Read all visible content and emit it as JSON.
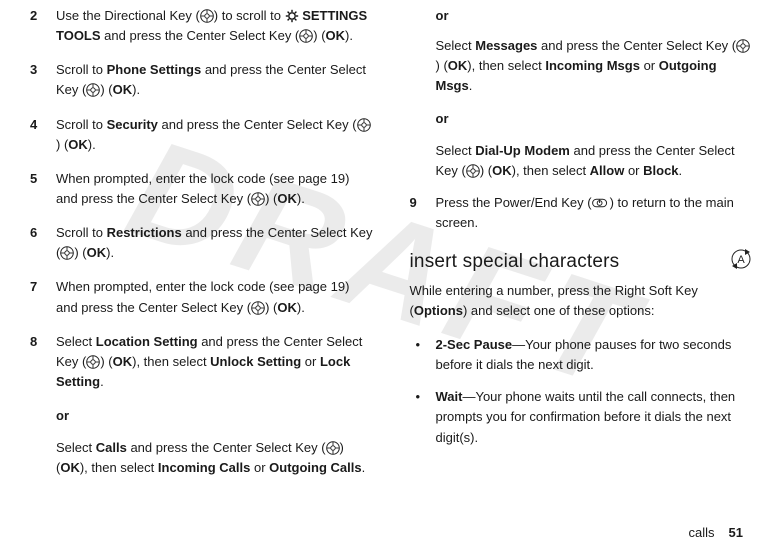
{
  "watermark": "DRAFT",
  "icon_names": {
    "dpad": "dpad-icon",
    "gear": "gear-icon",
    "power": "power-end-icon",
    "abc": "abc-mode-icon"
  },
  "left": {
    "steps": [
      {
        "num": "2",
        "parts": [
          "Use the Directional Key (",
          ") to scroll to ",
          " SETTINGS TOOLS",
          " and press the Center Select Key (",
          ") (",
          "OK",
          ")."
        ]
      },
      {
        "num": "3",
        "parts": [
          "Scroll to ",
          "Phone Settings",
          " and press the Center Select Key (",
          ") (",
          "OK",
          ")."
        ]
      },
      {
        "num": "4",
        "parts": [
          "Scroll to ",
          "Security",
          " and press the Center Select Key (",
          ") (",
          "OK",
          ")."
        ]
      },
      {
        "num": "5",
        "parts": [
          "When prompted, enter the lock code (see page 19) and press the Center Select Key (",
          ") (",
          "OK",
          ")."
        ]
      },
      {
        "num": "6",
        "parts": [
          "Scroll to ",
          "Restrictions",
          " and press the Center Select Key (",
          ") (",
          "OK",
          ")."
        ]
      },
      {
        "num": "7",
        "parts": [
          "When prompted, enter the lock code (see page 19) and press the Center Select Key (",
          ") (",
          "OK",
          ")."
        ]
      },
      {
        "num": "8",
        "parts": [
          "Select ",
          "Location Setting",
          " and press the Center Select Key (",
          ") (",
          "OK",
          "), then select ",
          "Unlock Setting",
          " or ",
          "Lock Setting",
          "."
        ]
      }
    ],
    "or1": "or",
    "calls": [
      "Select ",
      "Calls",
      " and press the Center Select Key (",
      ") (",
      "OK",
      "), then select ",
      "Incoming Calls",
      " or ",
      "Outgoing Calls",
      "."
    ]
  },
  "right": {
    "or1": "or",
    "messages": [
      "Select ",
      "Messages",
      " and press the Center Select Key (",
      ") (",
      "OK",
      "), then select ",
      "Incoming Msgs",
      " or ",
      "Outgoing Msgs",
      "."
    ],
    "or2": "or",
    "dialup": [
      "Select ",
      "Dial-Up Modem",
      " and press the Center Select Key (",
      ") (",
      "OK",
      "), then select ",
      "Allow",
      " or ",
      "Block",
      "."
    ],
    "step9": {
      "num": "9",
      "parts": [
        "Press the Power/End Key (",
        ") to return to the main screen."
      ]
    },
    "heading": "insert special characters",
    "intro": [
      "While entering a number, press the Right Soft Key (",
      "Options",
      ") and select one of these options:"
    ],
    "bullets": [
      {
        "dot": "•",
        "title": "2-Sec Pause",
        "text": "—Your phone pauses for two seconds before it dials the next digit."
      },
      {
        "dot": "•",
        "title": "Wait",
        "text": "—Your phone waits until the call connects, then prompts you for confirmation before it dials the next digit(s)."
      }
    ]
  },
  "footer": {
    "label": "calls",
    "page": "51"
  }
}
